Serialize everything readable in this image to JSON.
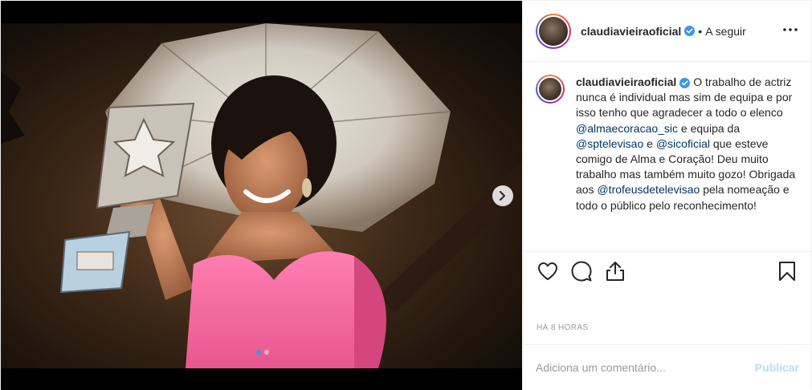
{
  "header": {
    "username": "claudiavieiraoficial",
    "separator": "•",
    "follow_label": "A seguir",
    "more_icon": "more-horizontal-icon"
  },
  "caption": {
    "username": "claudiavieiraoficial",
    "text_part1": "O trabalho de actriz nunca é individual mas sim de equipa e por isso tenho que agradecer a todo o elenco ",
    "mention1": "@almaecoracao_sic",
    "text_part2": " e equipa da ",
    "mention2": "@sptelevisao",
    "text_part3": " e ",
    "mention3": "@sicoficial",
    "text_part4": " que esteve comigo de Alma e Coração! Deu muito trabalho mas também muito gozo! Obrigada aos ",
    "mention4": "@trofeusdetelevisao",
    "text_part5": " pela nomeação e todo o público pelo reconhecimento!"
  },
  "actions": {
    "like_icon": "heart-icon",
    "comment_icon": "comment-icon",
    "share_icon": "share-icon",
    "save_icon": "bookmark-icon"
  },
  "timestamp": "HÁ 8 HORAS",
  "comment": {
    "placeholder": "Adiciona um comentário...",
    "publish_label": "Publicar"
  },
  "carousel": {
    "total_slides": 2,
    "active_slide": 1
  },
  "colors": {
    "verified": "#3897f0",
    "mention": "#003569",
    "publish_disabled": "#b2dffc",
    "dress_pink": "#f06aa0"
  }
}
